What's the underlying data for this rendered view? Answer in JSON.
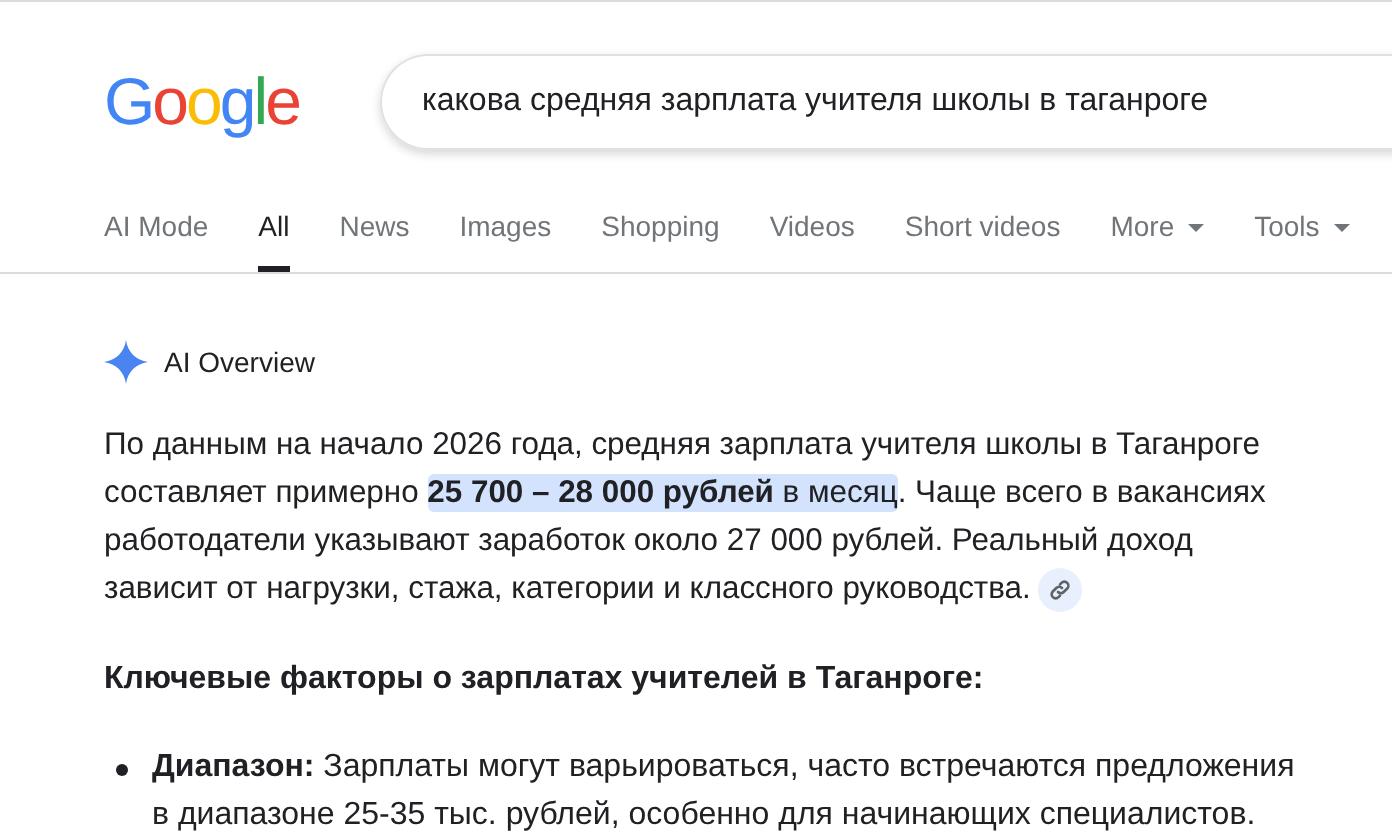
{
  "logo": "Google",
  "search": {
    "value": "какова средняя зарплата учителя школы в таганроге"
  },
  "tabs": [
    {
      "label": "AI Mode",
      "selected": false,
      "dropdown": false
    },
    {
      "label": "All",
      "selected": true,
      "dropdown": false
    },
    {
      "label": "News",
      "selected": false,
      "dropdown": false
    },
    {
      "label": "Images",
      "selected": false,
      "dropdown": false
    },
    {
      "label": "Shopping",
      "selected": false,
      "dropdown": false
    },
    {
      "label": "Videos",
      "selected": false,
      "dropdown": false
    },
    {
      "label": "Short videos",
      "selected": false,
      "dropdown": false
    },
    {
      "label": "More",
      "selected": false,
      "dropdown": true
    },
    {
      "label": "Tools",
      "selected": false,
      "dropdown": true
    }
  ],
  "ai_overview": {
    "title": "AI Overview",
    "paragraph": {
      "before": "По данным на начало 2026 года, средняя зарплата учителя школы в Таганроге составляет примерно ",
      "highlight": "**25 700 – 28 000 рублей** в месяц",
      "after": ". Чаще всего в вакансиях работодатели указывают заработок около 27 000 рублей. Реальный доход зависит от нагрузки, стажа, категории и классного руководства."
    },
    "heading": "Ключевые факторы о зарплатах учителей в Таганроге:",
    "bullets": [
      "**Диапазон:** Зарплаты могут варьироваться, часто встречаются предложения в диапазоне 25-35 тыс. рублей, особенно для начинающих специалистов."
    ]
  }
}
